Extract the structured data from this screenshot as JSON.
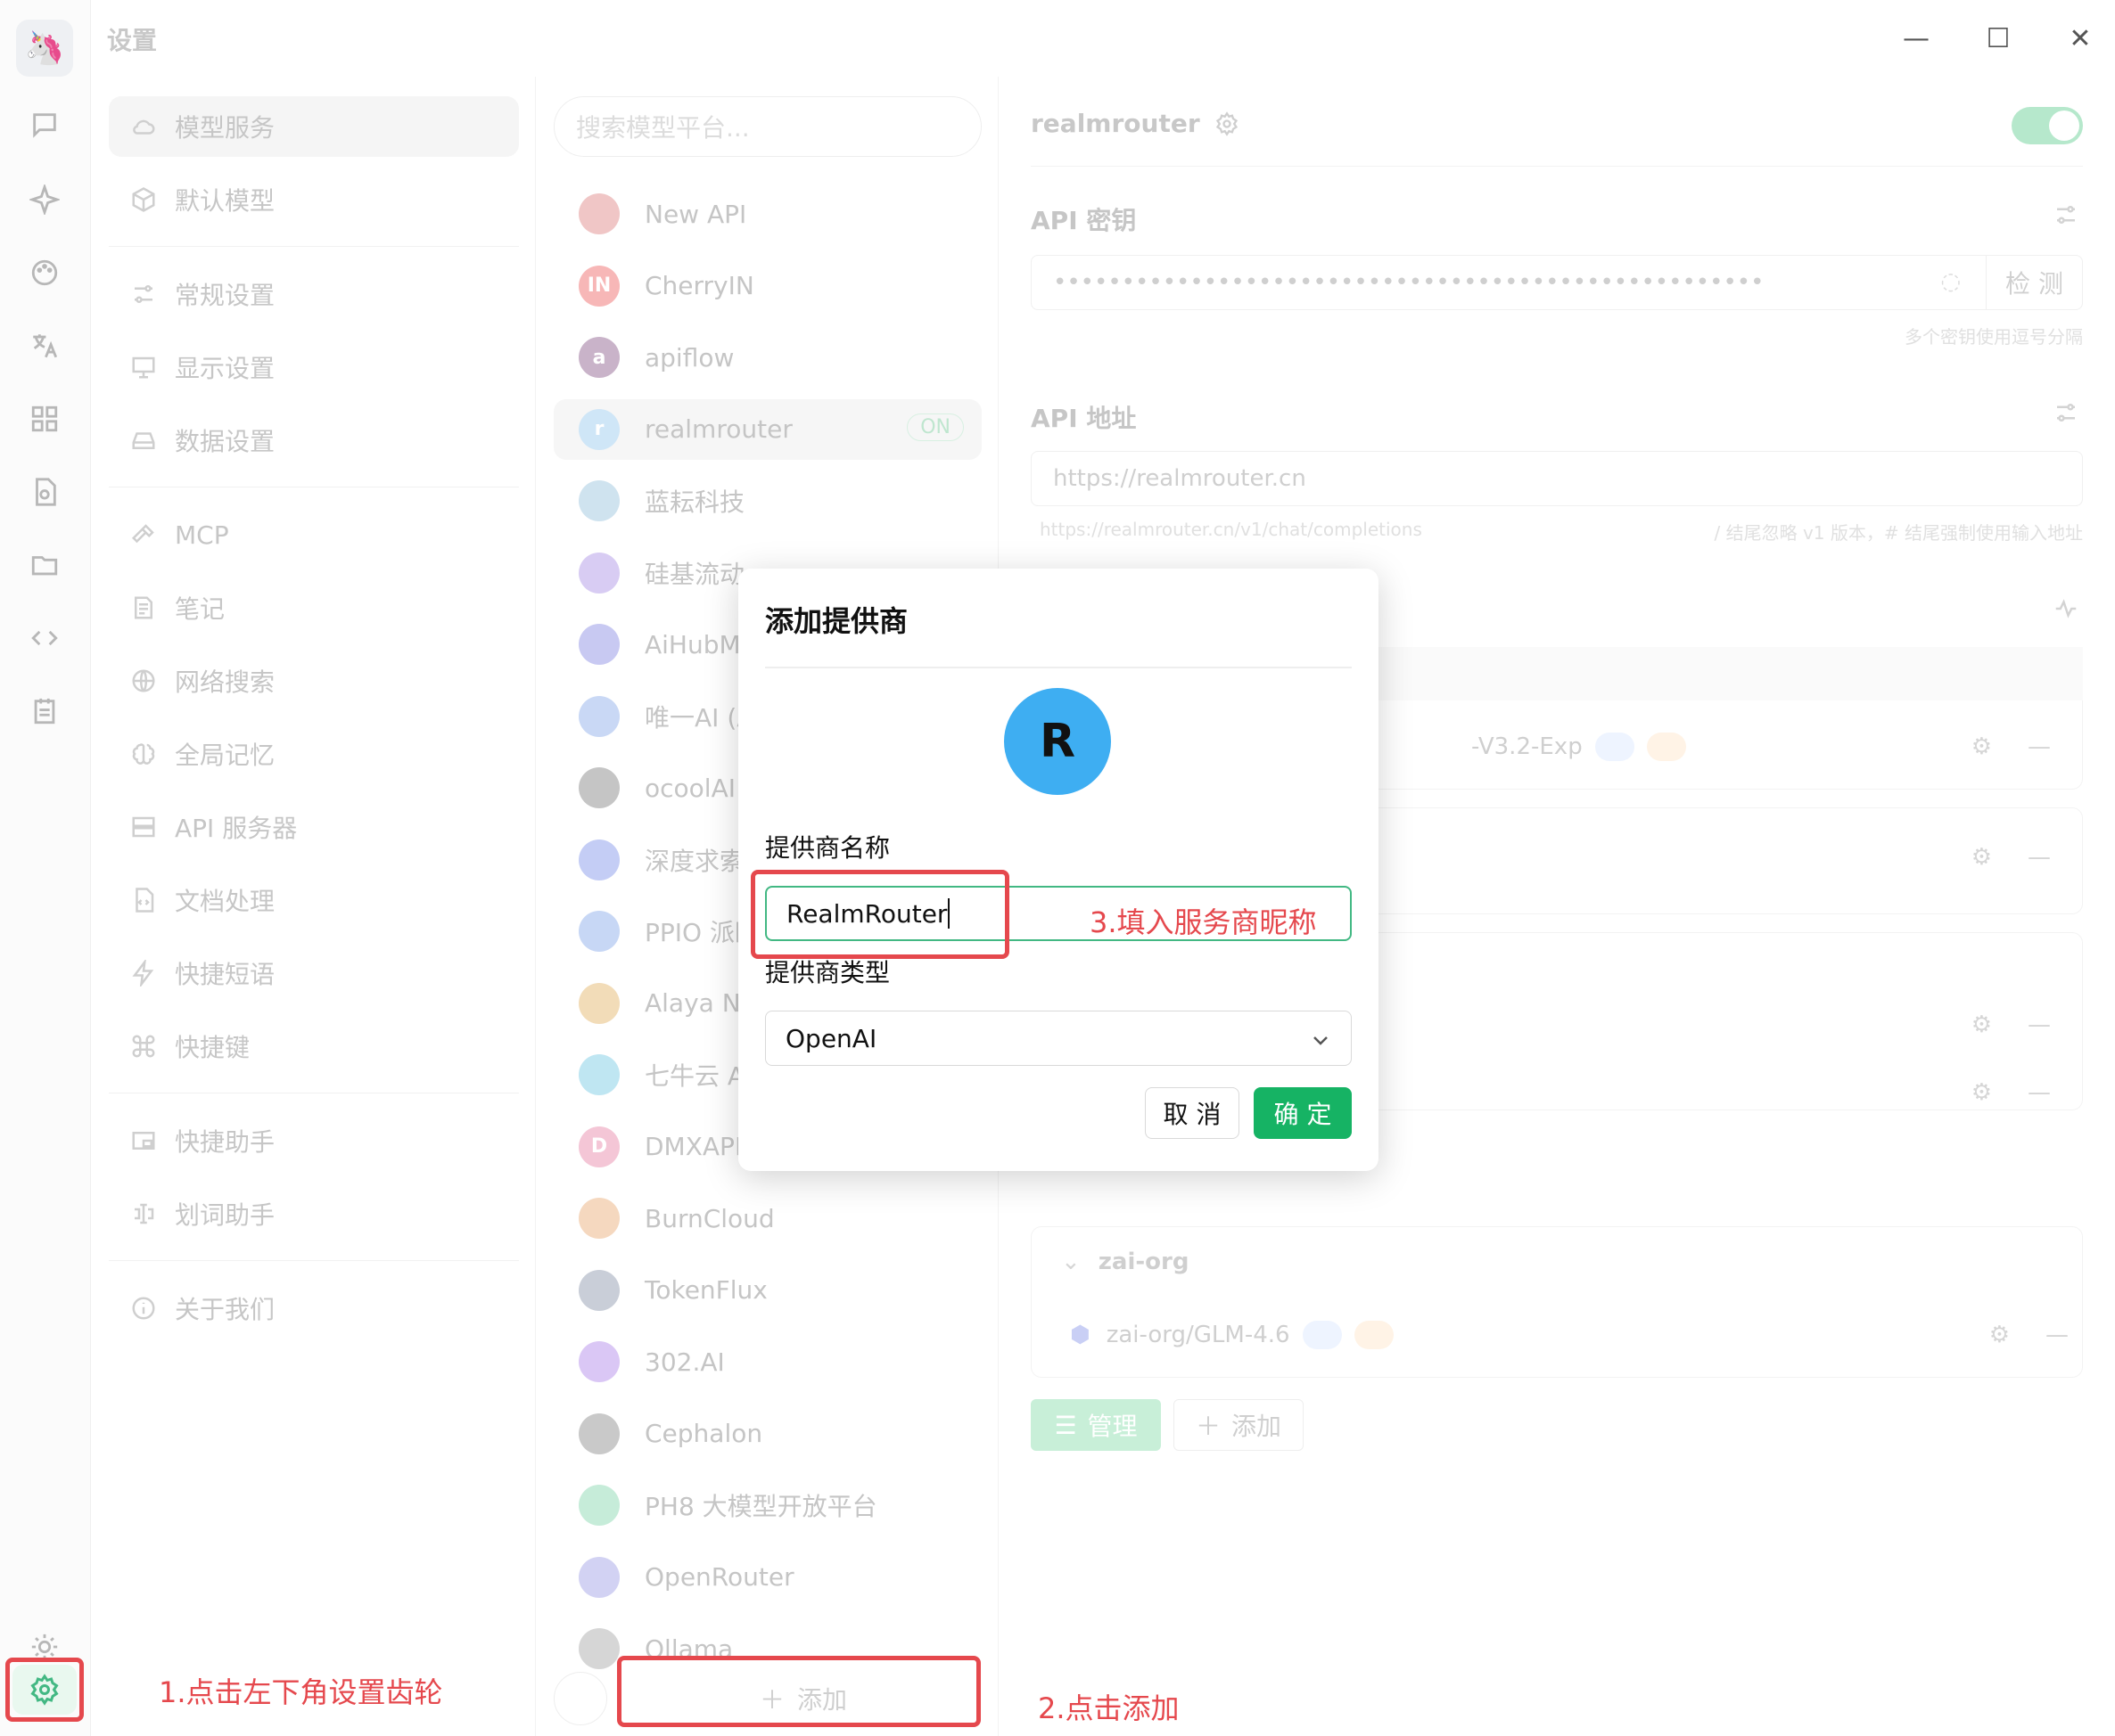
{
  "window": {
    "title": "设置",
    "minimize": "—",
    "maximize": "☐",
    "close": "✕"
  },
  "rail": {
    "logo_icon": "app-logo-icon",
    "items": [
      "chat-icon",
      "sparkle-icon",
      "palette-icon",
      "translate-icon",
      "apps-icon",
      "doc-search-icon",
      "folder-icon",
      "code-icon",
      "notes-icon"
    ],
    "bottom": [
      "theme-sun-icon",
      "settings-gear-icon"
    ]
  },
  "menu": {
    "items": [
      {
        "label": "模型服务",
        "icon": "cloud-icon"
      },
      {
        "label": "默认模型",
        "icon": "cube-icon"
      },
      {
        "label": "常规设置",
        "icon": "sliders-icon"
      },
      {
        "label": "显示设置",
        "icon": "monitor-icon"
      },
      {
        "label": "数据设置",
        "icon": "drive-icon"
      },
      {
        "label": "MCP",
        "icon": "hammer-icon"
      },
      {
        "label": "笔记",
        "icon": "note-icon"
      },
      {
        "label": "网络搜索",
        "icon": "globe-icon"
      },
      {
        "label": "全局记忆",
        "icon": "brain-icon"
      },
      {
        "label": "API 服务器",
        "icon": "server-icon"
      },
      {
        "label": "文档处理",
        "icon": "file-code-icon"
      },
      {
        "label": "快捷短语",
        "icon": "zap-icon"
      },
      {
        "label": "快捷键",
        "icon": "command-icon"
      },
      {
        "label": "快捷助手",
        "icon": "window-icon"
      },
      {
        "label": "划词助手",
        "icon": "text-cursor-icon"
      },
      {
        "label": "关于我们",
        "icon": "info-icon"
      }
    ]
  },
  "providers": {
    "search_placeholder": "搜索模型平台...",
    "items": [
      {
        "name": "New API",
        "avatar": "",
        "color": "#f0c6c6"
      },
      {
        "name": "CherryIN",
        "avatar": "IN",
        "color": "#f7b7b7"
      },
      {
        "name": "apiflow",
        "avatar": "a",
        "color": "#c9b3c9"
      },
      {
        "name": "realmrouter",
        "avatar": "r",
        "color": "#cfe6f7",
        "badge": "ON"
      },
      {
        "name": "蓝耘科技",
        "avatar": "",
        "color": "#cfe3ef"
      },
      {
        "name": "硅基流动",
        "avatar": "",
        "color": "#d8ccf3"
      },
      {
        "name": "AiHubMi",
        "avatar": "",
        "color": "#c8c9f2"
      },
      {
        "name": "唯一AI (A",
        "avatar": "",
        "color": "#c9d8f5"
      },
      {
        "name": "ocoolAI",
        "avatar": "",
        "color": "#c5c5c5"
      },
      {
        "name": "深度求索",
        "avatar": "",
        "color": "#c4cdf5"
      },
      {
        "name": "PPIO 派欧",
        "avatar": "",
        "color": "#c7d7f5"
      },
      {
        "name": "Alaya Ne",
        "avatar": "",
        "color": "#f2dcb8"
      },
      {
        "name": "七牛云 AI",
        "avatar": "",
        "color": "#bfe6f2"
      },
      {
        "name": "DMXAPI",
        "avatar": "D",
        "color": "#f4c6d6"
      },
      {
        "name": "BurnCloud",
        "avatar": "",
        "color": "#f5d8bf"
      },
      {
        "name": "TokenFlux",
        "avatar": "",
        "color": "#c9ced8"
      },
      {
        "name": "302.AI",
        "avatar": "",
        "color": "#dac7f5"
      },
      {
        "name": "Cephalon",
        "avatar": "",
        "color": "#c9c9c9"
      },
      {
        "name": "PH8 大模型开放平台",
        "avatar": "",
        "color": "#c6ecd9"
      },
      {
        "name": "OpenRouter",
        "avatar": "",
        "color": "#d2d2f3"
      },
      {
        "name": "Ollama",
        "avatar": "",
        "color": "#d6d6d6"
      }
    ],
    "add_label": "添加"
  },
  "detail": {
    "title": "realmrouter",
    "api_key_label": "API 密钥",
    "api_key_value": "••••••••••••••••••••••••••••••••••••••••••••••••••••",
    "check_label": "检 测",
    "api_key_hint": "多个密钥使用逗号分隔",
    "api_url_label": "API 地址",
    "api_url_value": "https://realmrouter.cn",
    "api_url_hint_left": "https://realmrouter.cn/v1/chat/completions",
    "api_url_hint_right": "/ 结尾忽略 v1 版本，# 结尾强制使用输入地址",
    "model_visible_1": "-V3.2-Exp",
    "group_zai": "zai-org",
    "model_zai": "zai-org/GLM-4.6",
    "manage_label": "管理",
    "add_label": "添加"
  },
  "modal": {
    "title": "添加提供商",
    "avatar_letter": "R",
    "name_label": "提供商名称",
    "name_value": "RealmRouter",
    "type_label": "提供商类型",
    "type_value": "OpenAI",
    "cancel_label": "取 消",
    "ok_label": "确 定"
  },
  "annotations": {
    "step1": "1.点击左下角设置齿轮",
    "step2": "2.点击添加",
    "step3": "3.填入服务商昵称"
  },
  "colors": {
    "accent": "#16b364",
    "annotation": "#e5484d",
    "avatar": "#3eaef2"
  }
}
